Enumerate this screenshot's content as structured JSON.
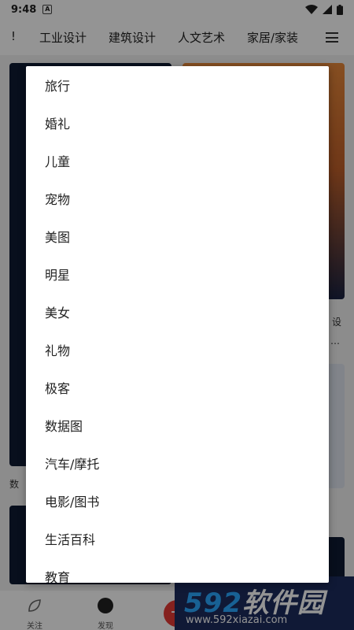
{
  "status_bar": {
    "time": "9:48",
    "notification_icon": "A"
  },
  "category_bar": {
    "items": [
      "!",
      "工业设计",
      "建筑设计",
      "人文艺术",
      "家居/家装"
    ]
  },
  "background": {
    "card_texts": [
      "数",
      "设",
      "…"
    ]
  },
  "bottom_nav": {
    "items": [
      {
        "label": "关注",
        "icon": "leaf-icon"
      },
      {
        "label": "发现",
        "icon": "compass-icon"
      }
    ],
    "fab_icon": "plus-icon"
  },
  "dropdown": {
    "items": [
      "旅行",
      "婚礼",
      "儿童",
      "宠物",
      "美图",
      "明星",
      "美女",
      "礼物",
      "极客",
      "数据图",
      "汽车/摩托",
      "电影/图书",
      "生活百科",
      "教育"
    ]
  },
  "watermark": {
    "brand_number": "592",
    "brand_text": "软件园",
    "url": "www.592xiazai.com"
  }
}
